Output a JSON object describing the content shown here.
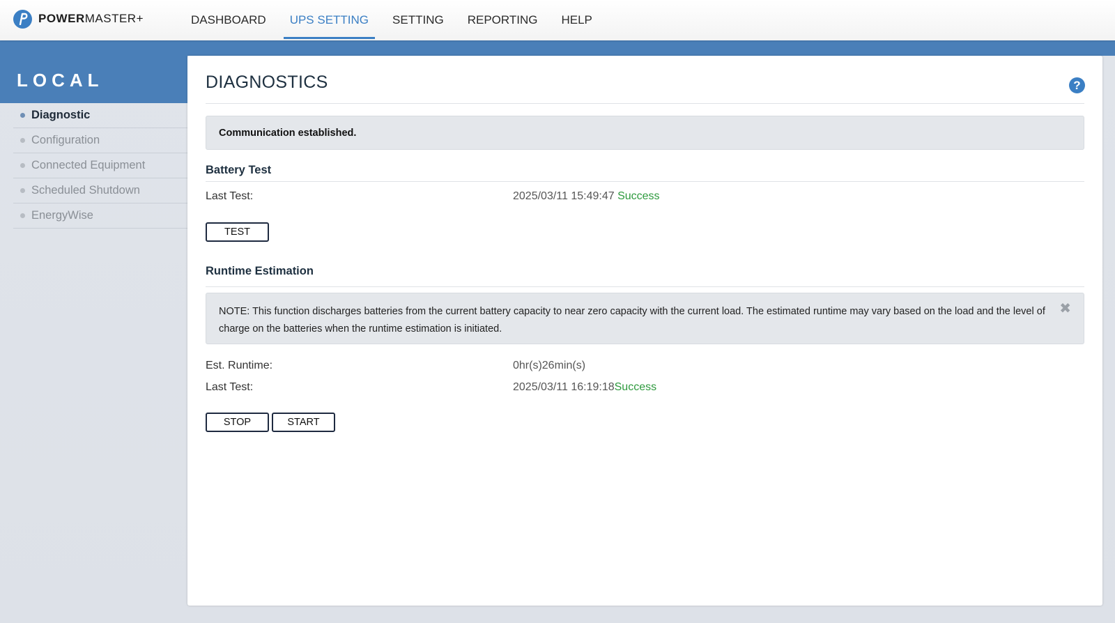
{
  "app": {
    "brand_bold": "POWER",
    "brand_rest": "MASTER+"
  },
  "nav": {
    "items": [
      {
        "label": "DASHBOARD"
      },
      {
        "label": "UPS SETTING"
      },
      {
        "label": "SETTING"
      },
      {
        "label": "REPORTING"
      },
      {
        "label": "HELP"
      }
    ],
    "active": "UPS SETTING"
  },
  "sidebar": {
    "title": "LOCAL",
    "items": [
      {
        "label": "Diagnostic"
      },
      {
        "label": "Configuration"
      },
      {
        "label": "Connected Equipment"
      },
      {
        "label": "Scheduled Shutdown"
      },
      {
        "label": "EnergyWise"
      }
    ],
    "active": "Diagnostic"
  },
  "main": {
    "title": "DIAGNOSTICS",
    "help_icon": "question-circle-icon",
    "status_message": "Communication established.",
    "battery_test": {
      "title": "Battery Test",
      "last_test_label": "Last Test:",
      "last_test_time": "2025/03/11 15:49:47",
      "last_test_result": "Success",
      "test_button": "TEST"
    },
    "runtime": {
      "title": "Runtime Estimation",
      "note": "NOTE: This function discharges batteries from the current battery capacity to near zero capacity with the current load. The estimated runtime may vary based on the load and the level of charge on the batteries when the runtime estimation is initiated.",
      "est_label": "Est. Runtime:",
      "est_value": "0hr(s)26min(s)",
      "last_test_label": "Last Test:",
      "last_test_time": "2025/03/11 16:19:18",
      "last_test_result": "Success",
      "stop_button": "STOP",
      "start_button": "START"
    }
  },
  "colors": {
    "accent": "#3b7fc4",
    "band": "#4a7fb8",
    "success": "#2e9a3e"
  }
}
